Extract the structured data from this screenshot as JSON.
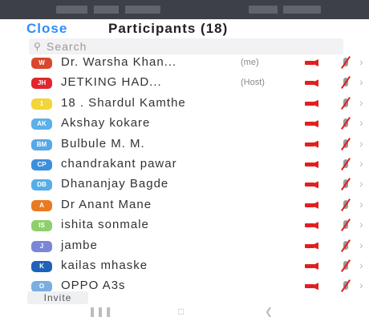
{
  "header": {
    "close_label": "Close",
    "title": "Participants (18)"
  },
  "search": {
    "placeholder": "Search",
    "icon": "search-icon"
  },
  "participants": [
    {
      "initials": "W",
      "avatar_color": "#d9482e",
      "name": "Dr. Warsha Khan...",
      "role": "(me)",
      "mic": "muted",
      "video": "off"
    },
    {
      "initials": "JH",
      "avatar_color": "#e0262e",
      "name": "JETKING HAD...",
      "role": "(Host)",
      "mic": "muted",
      "video": "off"
    },
    {
      "initials": "1",
      "avatar_color": "#f3d43a",
      "name": "18 . Shardul Kamthe",
      "role": "",
      "mic": "muted",
      "video": "off"
    },
    {
      "initials": "AK",
      "avatar_color": "#5ab0ea",
      "name": "Akshay kokare",
      "role": "",
      "mic": "muted",
      "video": "off"
    },
    {
      "initials": "BM",
      "avatar_color": "#57a8e6",
      "name": "Bulbule M. M.",
      "role": "",
      "mic": "muted",
      "video": "off"
    },
    {
      "initials": "CP",
      "avatar_color": "#3c8fdc",
      "name": "chandrakant pawar",
      "role": "",
      "mic": "muted",
      "video": "off"
    },
    {
      "initials": "DB",
      "avatar_color": "#55aee8",
      "name": "Dhananjay Bagde",
      "role": "",
      "mic": "muted",
      "video": "off"
    },
    {
      "initials": "A",
      "avatar_color": "#ea7a22",
      "name": "Dr Anant Mane",
      "role": "",
      "mic": "muted",
      "video": "off"
    },
    {
      "initials": "IS",
      "avatar_color": "#8fcf6e",
      "name": "ishita sonmale",
      "role": "",
      "mic": "muted",
      "video": "off"
    },
    {
      "initials": "J",
      "avatar_color": "#7b86d6",
      "name": "jambe",
      "role": "",
      "mic": "muted",
      "video": "off"
    },
    {
      "initials": "K",
      "avatar_color": "#1f62b8",
      "name": "kailas mhaske",
      "role": "",
      "mic": "muted",
      "video": "off"
    },
    {
      "initials": "O",
      "avatar_color": "#7aaee0",
      "name": "OPPO A3s",
      "role": "",
      "mic": "muted",
      "video": "off"
    }
  ],
  "footer": {
    "invite_label": "Invite"
  },
  "colors": {
    "accent": "#2d8cff",
    "muted": "#e02020",
    "statusbar": "#3d4047"
  }
}
